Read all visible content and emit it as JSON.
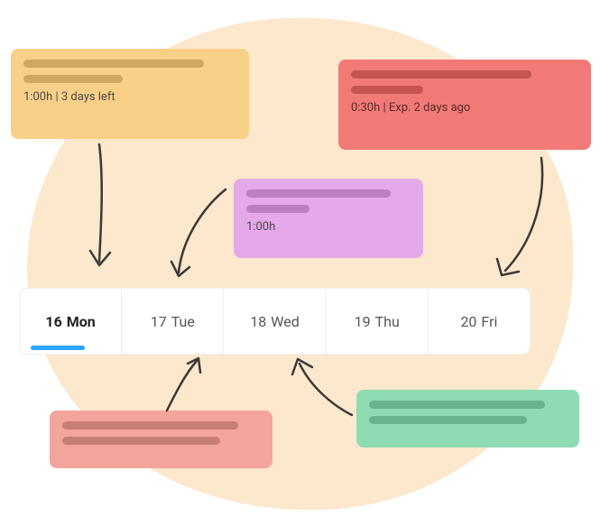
{
  "cards": {
    "orange": {
      "meta": "1:00h | 3 days left"
    },
    "red": {
      "meta": "0:30h | Exp. 2 days ago"
    },
    "purple": {
      "meta": "1:00h"
    }
  },
  "week": {
    "days": [
      {
        "num": "16",
        "dow": "Mon",
        "selected": true
      },
      {
        "num": "17",
        "dow": "Tue",
        "selected": false
      },
      {
        "num": "18",
        "dow": "Wed",
        "selected": false
      },
      {
        "num": "19",
        "dow": "Thu",
        "selected": false
      },
      {
        "num": "20",
        "dow": "Fri",
        "selected": false
      }
    ]
  },
  "colors": {
    "blob": "#fce8cd",
    "orange": "#f9d087",
    "red": "#f17a76",
    "purple": "#e5a8e9",
    "pink": "#f3a59c",
    "green": "#8fdbb4",
    "accent": "#2aa7ff"
  }
}
